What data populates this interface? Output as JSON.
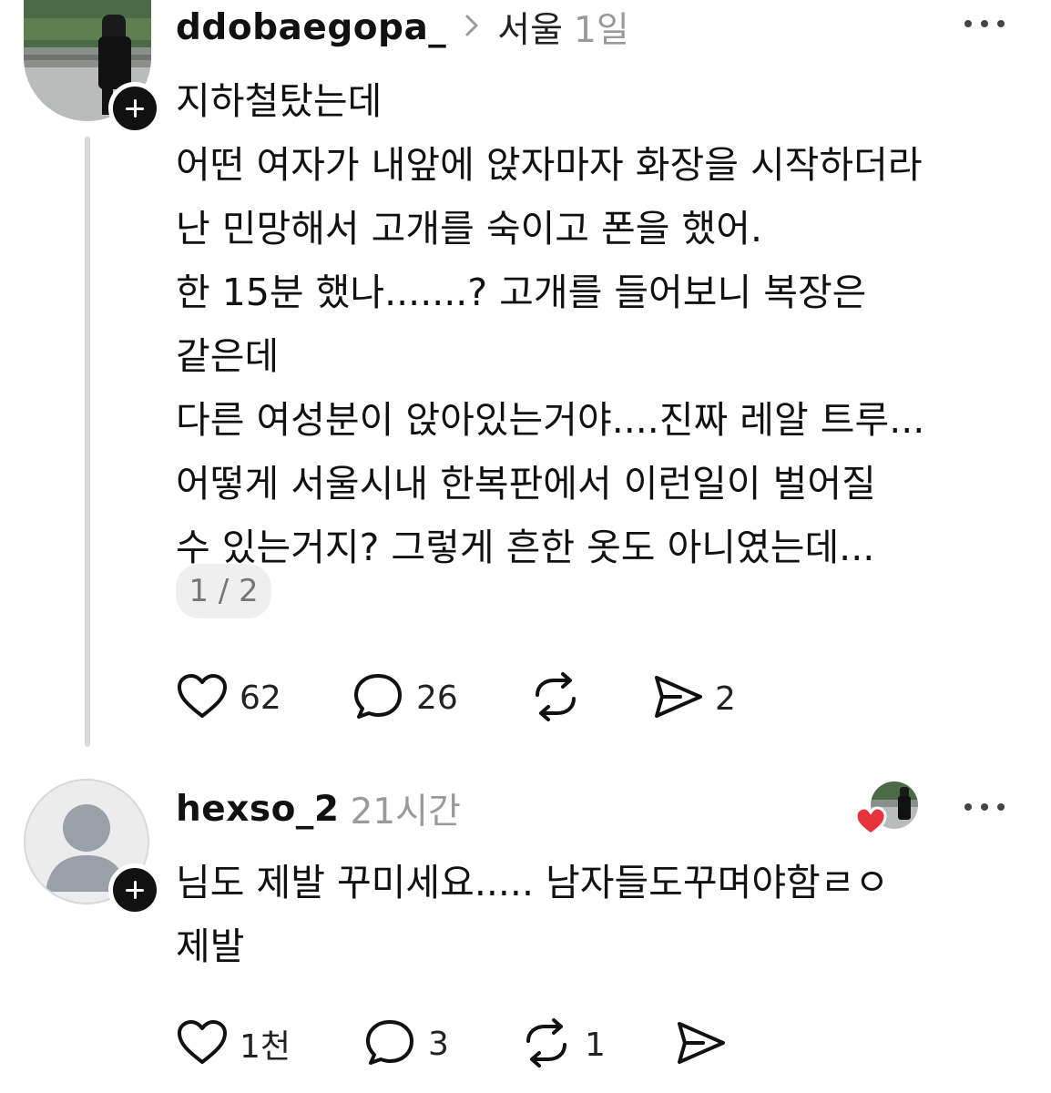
{
  "posts": [
    {
      "username": "ddobaegopa_",
      "location": "서울",
      "time": "1일",
      "lines": [
        "지하철탔는데",
        "어떤 여자가 내앞에 앉자마자 화장을 시작하더라",
        "난 민망해서 고개를 숙이고 폰을 했어.",
        "한 15분 했나.......? 고개를 들어보니 복장은",
        "같은데",
        "다른 여성분이 앉아있는거야....진짜 레알 트루...",
        "어떻게 서울시내 한복판에서 이런일이 벌어질",
        "수 있는거지? 그렇게 흔한 옷도 아니였는데..."
      ],
      "pager": "1 / 2",
      "likes": "62",
      "comments": "26",
      "reposts": "",
      "shares": "2"
    },
    {
      "username": "hexso_2",
      "time": "21시간",
      "lines": [
        "님도 제발 꾸미세요..... 남자들도꾸며야함ㄹㅇ",
        "제발"
      ],
      "likes": "1천",
      "comments": "3",
      "reposts": "1",
      "shares": ""
    }
  ],
  "colors": {
    "like_badge": "#e8323c",
    "muted": "#9a9a9a"
  }
}
